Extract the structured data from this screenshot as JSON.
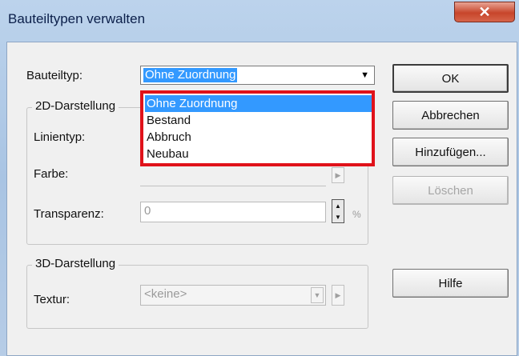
{
  "window": {
    "title": "Bauteiltypen verwalten",
    "close_glyph": "✕"
  },
  "form": {
    "bauteiltyp_label": "Bauteiltyp:",
    "bauteiltyp_value": "Ohne Zuordnung",
    "dropdown_options": [
      "Ohne Zuordnung",
      "Bestand",
      "Abbruch",
      "Neubau"
    ],
    "selected_option_index": 0
  },
  "group2d": {
    "title": "2D-Darstellung",
    "linientyp_label": "Linientyp:",
    "farbe_label": "Farbe:",
    "transparenz_label": "Transparenz:",
    "transparenz_value": "0",
    "transparenz_unit": "%"
  },
  "group3d": {
    "title": "3D-Darstellung",
    "textur_label": "Textur:",
    "textur_value": "<keine>"
  },
  "buttons": {
    "ok": "OK",
    "abbrechen": "Abbrechen",
    "hinzufuegen": "Hinzufügen...",
    "loeschen": "Löschen",
    "hilfe": "Hilfe"
  },
  "colors": {
    "highlight": "#3399ff",
    "callout_border": "#e0121a",
    "close_button": "#c7452b"
  }
}
